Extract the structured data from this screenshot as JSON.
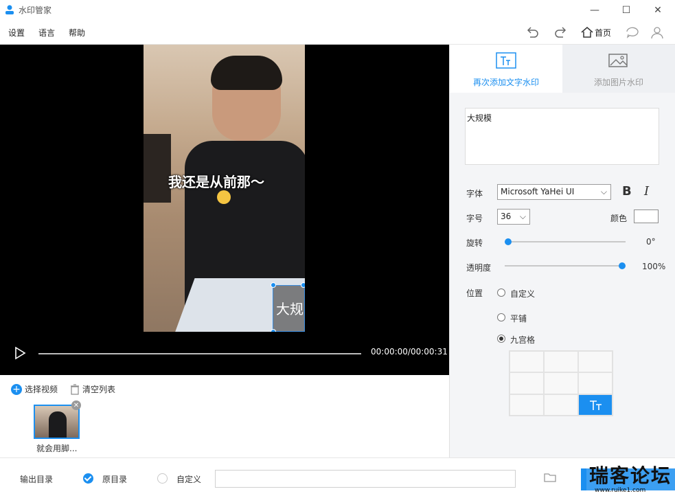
{
  "titlebar": {
    "title": "水印管家",
    "minimize": "—",
    "maximize": "☐",
    "close": "✕"
  },
  "menu": {
    "settings": "设置",
    "language": "语言",
    "help": "帮助",
    "home": "首页"
  },
  "preview": {
    "subtitle": "我还是从前那～",
    "watermark_text": "大规"
  },
  "player": {
    "time": "00:00:00/00:00:31",
    "progress": 0
  },
  "list": {
    "add_video": "选择视频",
    "clear_list": "清空列表",
    "items": [
      {
        "label": "就会用脚..."
      }
    ]
  },
  "panel": {
    "tab_text": "再次添加文字水印",
    "tab_image": "添加图片水印",
    "watermark_content": "大规模",
    "font_label": "字体",
    "font_value": "Microsoft YaHei UI",
    "bold": "B",
    "italic": "I",
    "size_label": "字号",
    "size_value": "36",
    "color_label": "颜色",
    "color_value": "#ffffff",
    "rotate_label": "旋转",
    "rotate_value": "0°",
    "rotate_fraction": 0,
    "opacity_label": "透明度",
    "opacity_value": "100%",
    "opacity_fraction": 1,
    "position_label": "位置",
    "pos_custom": "自定义",
    "pos_tile": "平铺",
    "pos_grid": "九宫格",
    "selected_position": "九宫格",
    "grid_selected_cell": "bottom-right"
  },
  "bottom": {
    "output_label": "输出目录",
    "original_dir": "原目录",
    "custom_dir": "自定义",
    "path_value": ""
  },
  "overlay": {
    "forum_name": "瑞客论坛",
    "forum_url": "www.ruike1.com"
  },
  "colors": {
    "accent": "#1b8ff0"
  }
}
